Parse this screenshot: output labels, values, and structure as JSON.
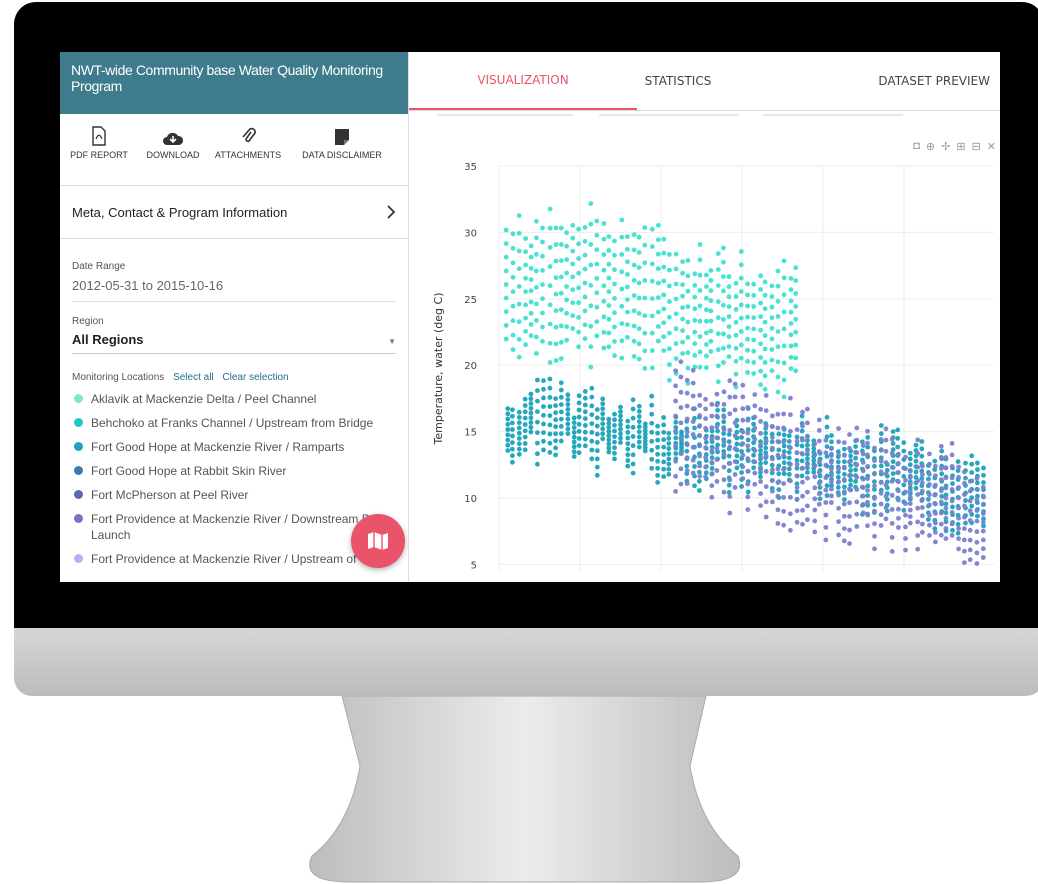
{
  "sidebar": {
    "title": "NWT-wide Community base Water Quality Monitoring Program",
    "tools": [
      {
        "label": "PDF REPORT",
        "icon": "pdf-icon"
      },
      {
        "label": "DOWNLOAD",
        "icon": "cloud-download-icon"
      },
      {
        "label": "ATTACHMENTS",
        "icon": "paperclip-icon"
      },
      {
        "label": "DATA DISCLAIMER",
        "icon": "note-icon"
      }
    ],
    "meta_link": "Meta, Contact & Program Information",
    "date_range_label": "Date Range",
    "date_range_value": "2012-05-31  to  2015-10-16",
    "region_label": "Region",
    "region_value": "All Regions",
    "locations_label": "Monitoring Locations",
    "select_all": "Select all",
    "clear_selection": "Clear selection",
    "locations": [
      {
        "name": "Aklavik at Mackenzie Delta / Peel Channel",
        "color": "#7fe6cf"
      },
      {
        "name": "Behchoko at Franks Channel / Upstream from Bridge",
        "color": "#20c9c0"
      },
      {
        "name": "Fort Good Hope at Mackenzie River / Ramparts",
        "color": "#1ea3b9"
      },
      {
        "name": "Fort Good Hope at Rabbit Skin River",
        "color": "#3d79b5"
      },
      {
        "name": "Fort McPherson at Peel River",
        "color": "#5a66b8"
      },
      {
        "name": "Fort Providence at Mackenzie River / Downstream Boat Launch",
        "color": "#7e6dc7"
      },
      {
        "name": "Fort Providence at Mackenzie River / Upstream of",
        "color": "#b8b0ec"
      }
    ]
  },
  "main": {
    "tabs": [
      "VISUALIZATION",
      "STATISTICS",
      "DATASET PREVIEW"
    ],
    "active_tab": "VISUALIZATION"
  },
  "colors": {
    "accent": "#e9546b",
    "header": "#3e7b8c"
  },
  "chart_data": {
    "type": "scatter",
    "ylabel": "Temperature, water (deg C)",
    "y_ticks": [
      5,
      10,
      15,
      20,
      25,
      30,
      35
    ],
    "ylim": [
      4.5,
      35
    ],
    "grid": true,
    "series": [
      {
        "values_range": [
          [
            22,
            30
          ],
          [
            21,
            31
          ],
          [
            20,
            28
          ],
          [
            19,
            27
          ],
          [
            17,
            25
          ],
          [
            16,
            24
          ]
        ],
        "color": "#3fe0cf"
      },
      {
        "values_range": [
          [
            14,
            18
          ],
          [
            13,
            17
          ],
          [
            12,
            16
          ],
          [
            11,
            15
          ],
          [
            10,
            14
          ],
          [
            8,
            13
          ]
        ],
        "color": "#1aa3b8"
      },
      {
        "values_range": [
          [
            13,
            21
          ],
          [
            12,
            20
          ],
          [
            11,
            19
          ],
          [
            9,
            16
          ],
          [
            7,
            14
          ],
          [
            6,
            12
          ]
        ],
        "color": "#7c7fd0"
      }
    ]
  }
}
